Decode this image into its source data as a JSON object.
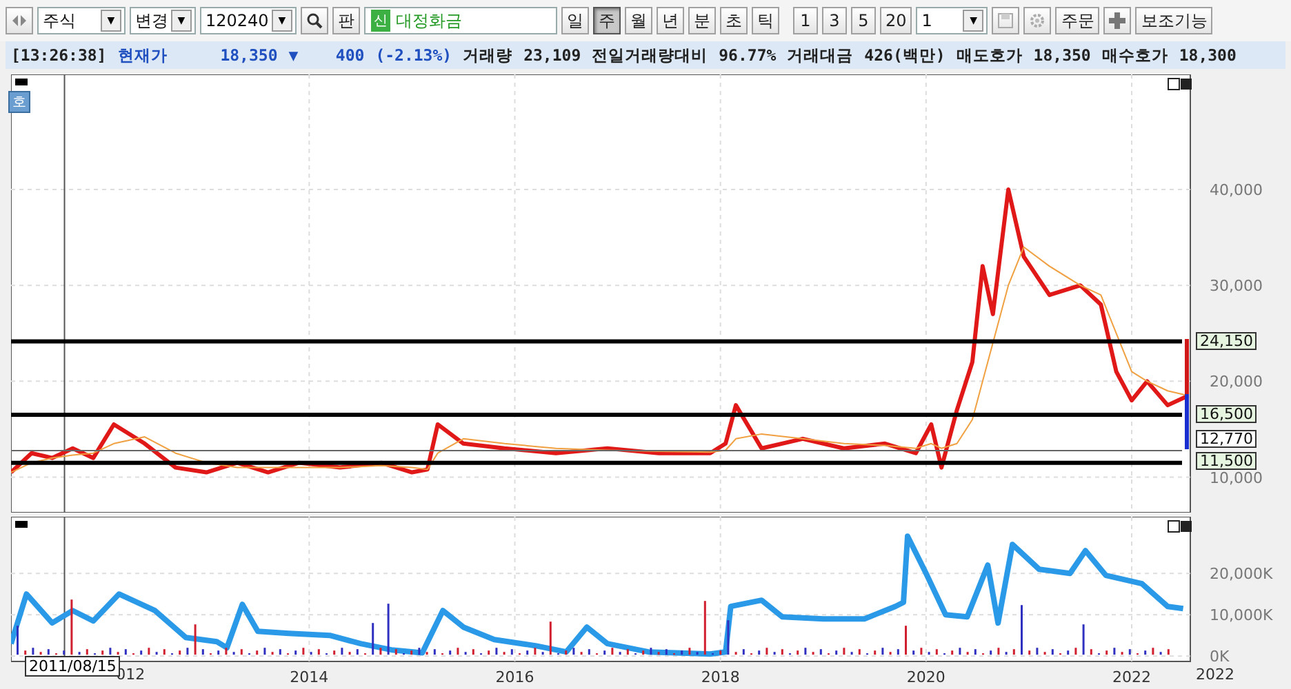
{
  "toolbar": {
    "market": "주식",
    "mode": "변경",
    "code": "120240",
    "chart_button": "판",
    "new_badge": "신",
    "stock_name": "대정화금",
    "periods": [
      {
        "label": "일",
        "selected": false
      },
      {
        "label": "주",
        "selected": true
      },
      {
        "label": "월",
        "selected": false
      },
      {
        "label": "년",
        "selected": false
      },
      {
        "label": "분",
        "selected": false
      },
      {
        "label": "초",
        "selected": false
      },
      {
        "label": "틱",
        "selected": false
      }
    ],
    "intervals": [
      "1",
      "3",
      "5",
      "20"
    ],
    "interval_value": "1",
    "order_button": "주문",
    "extra_button": "보조기능"
  },
  "quote_bar": {
    "time": "[13:26:38]",
    "price_label": "현재가",
    "price": "18,350",
    "direction": "▼",
    "change": "400",
    "change_rate": "(-2.13%)",
    "fields": [
      {
        "label": "거래량",
        "value": "23,109"
      },
      {
        "label": "전일거래량대비",
        "value": "96.77%"
      },
      {
        "label": "거래대금",
        "value": "426(백만)"
      },
      {
        "label": "매도호가",
        "value": "18,350"
      },
      {
        "label": "매수호가",
        "value": "18,300"
      }
    ]
  },
  "side_button": "호",
  "price_chart": {
    "thin_level_lines": [
      false,
      false,
      true,
      false
    ],
    "chart_data": {
      "type": "line",
      "grid": true,
      "xlim": [
        2011.1,
        2022.57
      ],
      "ylim": [
        6300,
        52000
      ],
      "ref_lines": [
        {
          "axis": "y",
          "value": 24150,
          "label": "24,150"
        },
        {
          "axis": "y",
          "value": 16500,
          "label": "16,500"
        },
        {
          "axis": "y",
          "value": 12770,
          "label": "12,770"
        },
        {
          "axis": "y",
          "value": 11500,
          "label": "11,500"
        },
        {
          "axis": "x",
          "value": 2011.62
        }
      ],
      "x": [
        2011.1,
        2011.3,
        2011.5,
        2011.7,
        2011.9,
        2012.1,
        2012.4,
        2012.7,
        2013.0,
        2013.3,
        2013.6,
        2013.9,
        2014.3,
        2014.7,
        2015.0,
        2015.15,
        2015.25,
        2015.5,
        2015.9,
        2016.4,
        2016.9,
        2017.4,
        2017.9,
        2018.05,
        2018.15,
        2018.4,
        2018.8,
        2019.2,
        2019.6,
        2019.9,
        2020.05,
        2020.15,
        2020.3,
        2020.45,
        2020.55,
        2020.65,
        2020.8,
        2020.95,
        2021.2,
        2021.5,
        2021.7,
        2021.85,
        2022.0,
        2022.15,
        2022.35,
        2022.55
      ],
      "series": [
        {
          "color": "#e01818",
          "values": [
            10500,
            12500,
            12000,
            13000,
            12000,
            15500,
            13500,
            11000,
            10500,
            11500,
            10500,
            11500,
            11000,
            11500,
            10500,
            10800,
            15500,
            13500,
            13000,
            12500,
            13000,
            12500,
            12500,
            13500,
            17500,
            13000,
            14000,
            13000,
            13500,
            12500,
            15500,
            11000,
            17000,
            22000,
            32000,
            27000,
            40000,
            33000,
            29000,
            30000,
            28000,
            21000,
            18000,
            20000,
            17500,
            18500
          ]
        },
        {
          "color": "#f0a040",
          "values": [
            10500,
            11500,
            12000,
            12300,
            12500,
            13500,
            14200,
            12500,
            11500,
            11000,
            11000,
            11000,
            11000,
            11200,
            11000,
            10800,
            12500,
            14000,
            13500,
            13000,
            12800,
            12700,
            12600,
            12800,
            14000,
            14500,
            14000,
            13500,
            13300,
            13000,
            13500,
            13000,
            13500,
            16000,
            20000,
            24000,
            30000,
            34000,
            32000,
            30000,
            29000,
            25000,
            21000,
            20000,
            19000,
            18500
          ]
        }
      ],
      "yticks": [
        {
          "value": 10000,
          "label": "10,000"
        },
        {
          "value": 20000,
          "label": "20,000"
        },
        {
          "value": 30000,
          "label": "30,000"
        },
        {
          "value": 40000,
          "label": "40,000"
        }
      ]
    }
  },
  "volume_chart": {
    "chart_data": {
      "type": "line",
      "grid": true,
      "xlim": [
        2011.1,
        2022.57
      ],
      "ylim": [
        -1300,
        33700
      ],
      "ref_lines": [
        {
          "axis": "x",
          "value": 2011.62
        }
      ],
      "x": [
        2011.1,
        2011.25,
        2011.5,
        2011.7,
        2011.9,
        2012.15,
        2012.5,
        2012.8,
        2013.1,
        2013.2,
        2013.35,
        2013.5,
        2013.8,
        2014.2,
        2014.5,
        2014.8,
        2015.1,
        2015.3,
        2015.5,
        2015.8,
        2016.2,
        2016.5,
        2016.7,
        2016.9,
        2017.3,
        2017.9,
        2018.05,
        2018.1,
        2018.4,
        2018.6,
        2019.0,
        2019.4,
        2019.7,
        2019.78,
        2019.82,
        2020.0,
        2020.19,
        2020.4,
        2020.6,
        2020.7,
        2020.84,
        2021.1,
        2021.4,
        2021.55,
        2021.75,
        2022.1,
        2022.35,
        2022.5
      ],
      "series": [
        {
          "color": "#2a9ae8",
          "values": [
            3000,
            15000,
            8000,
            11000,
            8500,
            15000,
            11000,
            4500,
            3500,
            2000,
            12500,
            6000,
            5500,
            5000,
            3000,
            1500,
            800,
            11000,
            7000,
            4000,
            2500,
            1000,
            7000,
            3000,
            1000,
            500,
            1000,
            12000,
            13500,
            9500,
            9000,
            9000,
            12000,
            13000,
            29000,
            20000,
            10000,
            9500,
            22000,
            8000,
            27000,
            21000,
            20000,
            25500,
            19500,
            17500,
            12000,
            11500
          ]
        }
      ],
      "xticks": [
        {
          "value": 2014,
          "label": "2014"
        },
        {
          "value": 2016,
          "label": "2016"
        },
        {
          "value": 2018,
          "label": "2018"
        },
        {
          "value": 2020,
          "label": "2020"
        },
        {
          "value": 2022,
          "label": "2022"
        }
      ],
      "yticks": [
        {
          "value": 0,
          "label": "0K"
        },
        {
          "value": 10000,
          "label": "10,000K"
        },
        {
          "value": 20000,
          "label": "20,000K"
        }
      ]
    },
    "covered_axis_label": "012",
    "edge_axis_label": "2022"
  },
  "crosshair_date": "2011/08/15"
}
